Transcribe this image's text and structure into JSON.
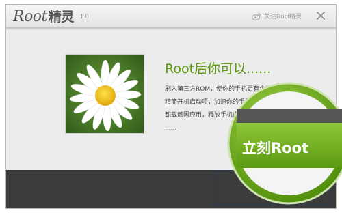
{
  "app": {
    "name_latin": "Root",
    "name_cn": "精灵",
    "version": "1.0"
  },
  "titlebar": {
    "follow_label": "关注Root精灵",
    "icons": [
      "weibo-icon",
      "close-icon"
    ]
  },
  "promo": {
    "headline": "Root后你可以......",
    "lines": [
      "刷入第三方ROM，使你的手机更有个性",
      "精简开机启动项，加速你的手机开机",
      "卸载顽固应用，释放手机内存空间",
      "......"
    ]
  },
  "cta": {
    "label": "立刻Root",
    "shadow_label": "oot"
  },
  "colors": {
    "accent_green": "#5a9a0a",
    "badge_green": "#6aa511",
    "bottom_bar": "#3b3b3b"
  }
}
